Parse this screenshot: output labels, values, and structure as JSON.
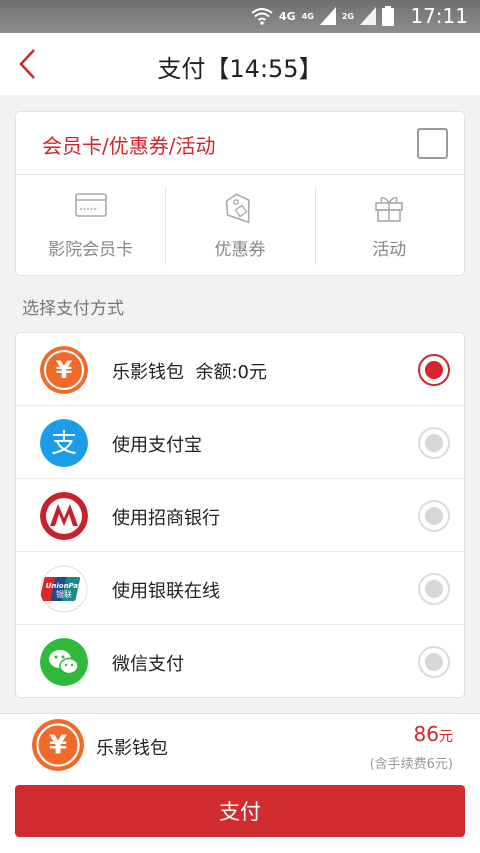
{
  "status_bar": {
    "network_primary": "4G",
    "network_secondary": "4G",
    "network_tertiary": "2G",
    "time": "17:11",
    "icons": [
      "wifi-icon",
      "signal-icon",
      "battery-icon"
    ]
  },
  "nav": {
    "title": "支付【14:55】",
    "back_icon": "chevron-left-icon"
  },
  "promo": {
    "label": "会员卡/优惠券/活动",
    "checked": false,
    "options": [
      {
        "label": "影院会员卡",
        "icon": "card-icon"
      },
      {
        "label": "优惠券",
        "icon": "coupon-tag-icon"
      },
      {
        "label": "活动",
        "icon": "gift-icon"
      }
    ]
  },
  "payment_section": {
    "title": "选择支付方式",
    "methods": [
      {
        "name": "乐影钱包  余额:0元",
        "icon": "yuan-wallet-icon",
        "selected": true
      },
      {
        "name": "使用支付宝",
        "icon": "alipay-icon",
        "selected": false
      },
      {
        "name": "使用招商银行",
        "icon": "cmb-icon",
        "selected": false
      },
      {
        "name": "使用银联在线",
        "icon": "unionpay-icon",
        "selected": false
      },
      {
        "name": "微信支付",
        "icon": "wechat-icon",
        "selected": false
      }
    ]
  },
  "summary": {
    "wallet_name": "乐影钱包",
    "amount": "86",
    "amount_unit": "元",
    "fee_note": "(含手续费6元)",
    "pay_button": "支付"
  },
  "unionpay_logo": {
    "top": "UnionPay",
    "bottom": "银联"
  },
  "colors": {
    "accent": "#d12c2f",
    "wallet_orange": "#f06a2a",
    "alipay_blue": "#1b9de7",
    "cmb_red": "#c8212b",
    "wechat_green": "#2fba3c",
    "unionpay_red": "#d92a2a",
    "unionpay_blue": "#1d4b8f",
    "unionpay_teal": "#1b8a86"
  }
}
